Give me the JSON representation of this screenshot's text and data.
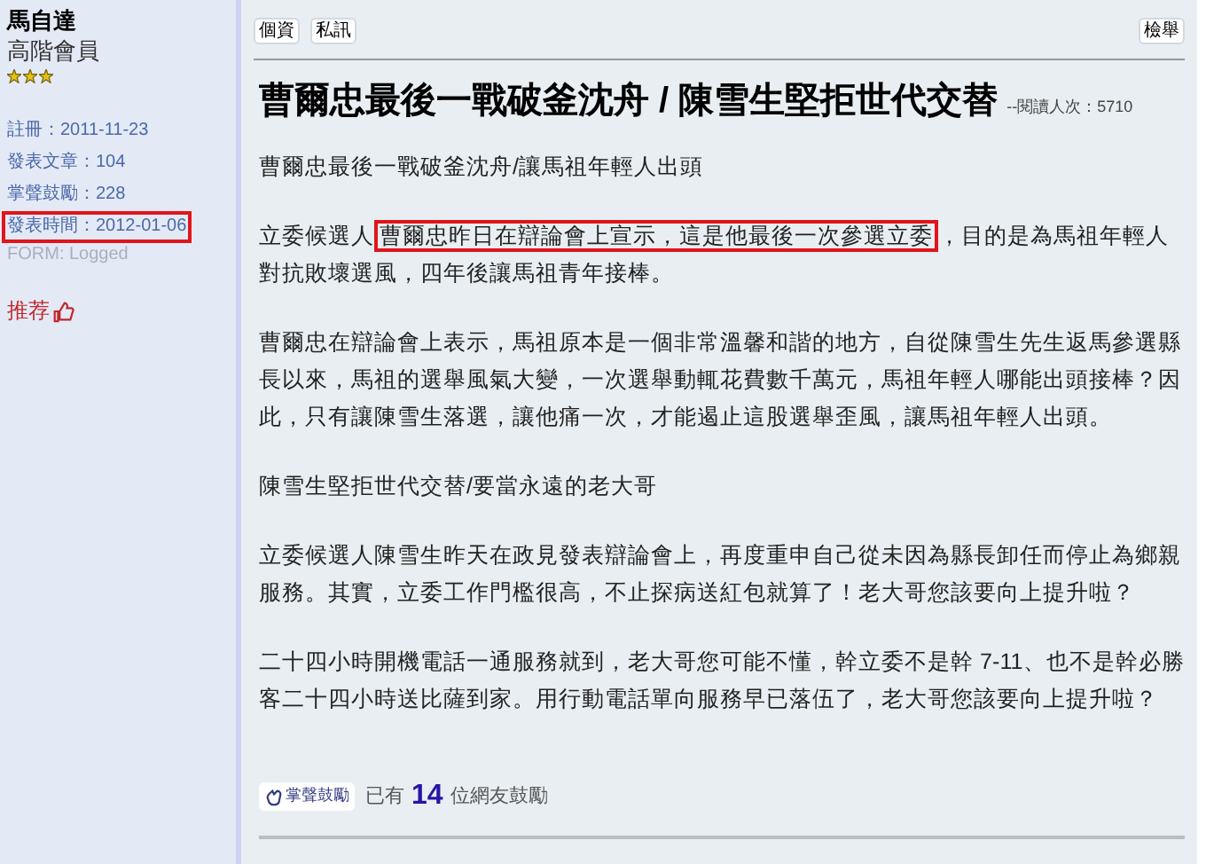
{
  "sidebar": {
    "username": "馬自達",
    "rank": "高階會員",
    "stats": [
      {
        "text": "註冊：2011-11-23",
        "highlighted": false
      },
      {
        "text": "發表文章：104",
        "highlighted": false
      },
      {
        "text": "掌聲鼓勵：228",
        "highlighted": false
      },
      {
        "text": "發表時間：2012-01-06",
        "highlighted": true
      }
    ],
    "form_status": "FORM: Logged",
    "recommend": "推荐"
  },
  "toolbar": {
    "left_buttons": [
      "個資",
      "私訊"
    ],
    "right_button": "檢舉"
  },
  "post": {
    "title": "曹爾忠最後一戰破釜沈舟 / 陳雪生堅拒世代交替",
    "views": "--閱讀人次：5710",
    "paragraphs": [
      {
        "before": "曹爾忠最後一戰破釜沈舟/讓馬祖年輕人出頭"
      },
      {
        "before": "立委候選人",
        "highlight": "曹爾忠昨日在辯論會上宣示，這是他最後一次參選立委",
        "after": "，目的是為馬祖年輕人對抗敗壞選風，四年後讓馬祖青年接棒。"
      },
      {
        "before": "曹爾忠在辯論會上表示，馬祖原本是一個非常溫馨和諧的地方，自從陳雪生先生返馬參選縣長以來，馬祖的選舉風氣大變，一次選舉動輒花費數千萬元，馬祖年輕人哪能出頭接棒？因此，只有讓陳雪生落選，讓他痛一次，才能遏止這股選舉歪風，讓馬祖年輕人出頭。"
      },
      {
        "before": "陳雪生堅拒世代交替/要當永遠的老大哥"
      },
      {
        "before": "立委候選人陳雪生昨天在政見發表辯論會上，再度重申自己從未因為縣長卸任而停止為鄉親服務。其實，立委工作門檻很高，不止探病送紅包就算了！老大哥您該要向上提升啦？"
      },
      {
        "before": "二十四小時開機電話一通服務就到，老大哥您可能不懂，幹立委不是幹 7-11、也不是幹必勝客二十四小時送比薩到家。用行動電話單向服務早已落伍了，老大哥您該要向上提升啦？"
      }
    ]
  },
  "footer": {
    "applaud_button": "掌聲鼓勵",
    "count_prefix": "已有",
    "count": "14",
    "count_suffix": "位網友鼓勵"
  }
}
